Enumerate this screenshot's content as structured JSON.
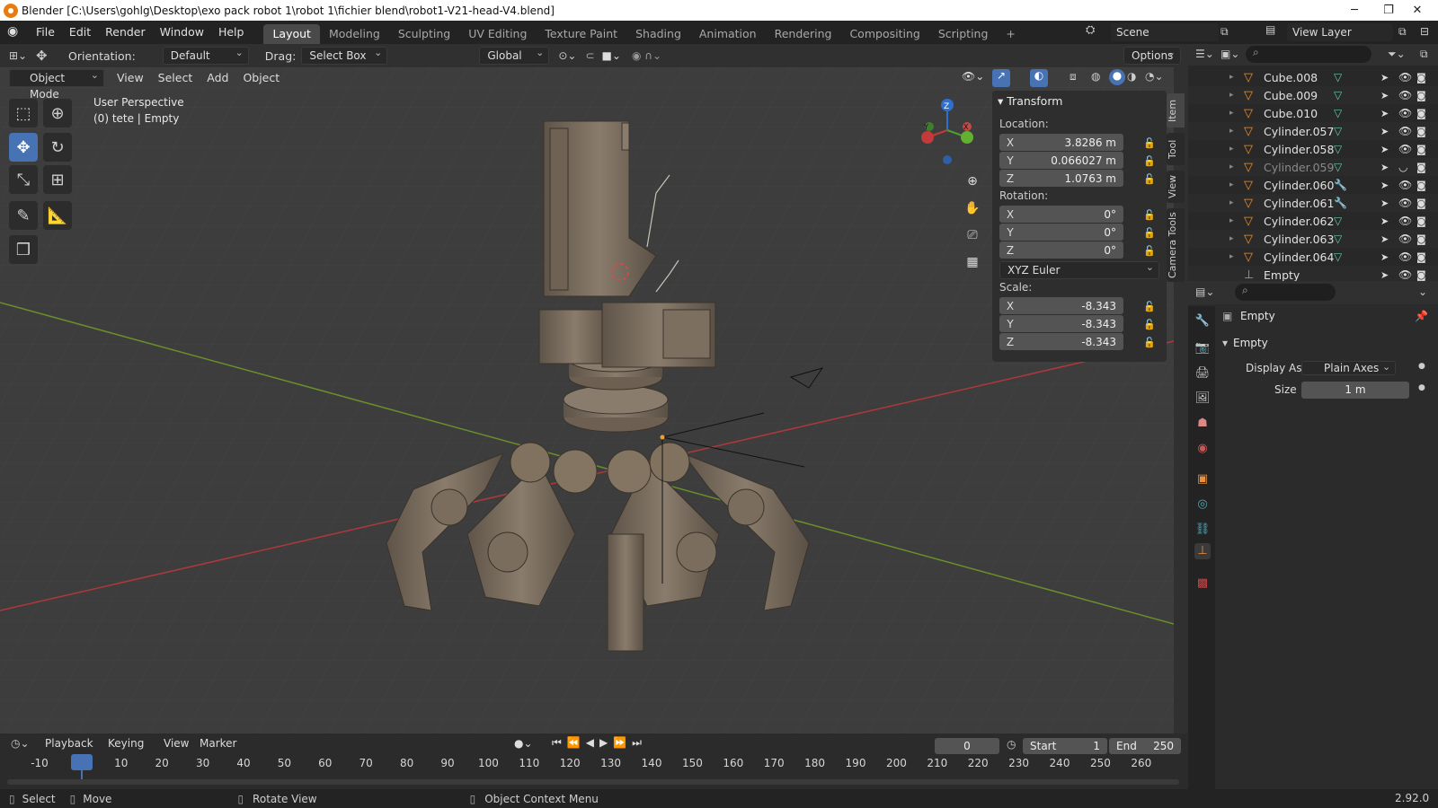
{
  "titlebar": {
    "title": "Blender [C:\\Users\\gohlg\\Desktop\\exo pack robot 1\\robot 1\\fichier blend\\robot1-V21-head-V4.blend]",
    "minimize": "─",
    "maximize": "❐",
    "close": "✕"
  },
  "menu": [
    "File",
    "Edit",
    "Render",
    "Window",
    "Help"
  ],
  "workspaces": [
    {
      "label": "Layout",
      "active": true
    },
    {
      "label": "Modeling"
    },
    {
      "label": "Sculpting"
    },
    {
      "label": "UV Editing"
    },
    {
      "label": "Texture Paint"
    },
    {
      "label": "Shading"
    },
    {
      "label": "Animation"
    },
    {
      "label": "Rendering"
    },
    {
      "label": "Compositing"
    },
    {
      "label": "Scripting"
    }
  ],
  "add_workspace": "+",
  "scene": {
    "label": "Scene"
  },
  "view_layer": {
    "label": "View Layer"
  },
  "tool_header": {
    "orientation_label": "Orientation:",
    "orientation_value": "Default",
    "drag_label": "Drag:",
    "drag_value": "Select Box",
    "transform_space": "Global",
    "options": "Options"
  },
  "viewport_header": {
    "mode": "Object Mode",
    "items": [
      "View",
      "Select",
      "Add",
      "Object"
    ]
  },
  "overlay_text": {
    "perspective": "User Perspective",
    "context": "(0) tete | Empty"
  },
  "gizmo": {
    "z": "Z",
    "y": "Y",
    "x": "X"
  },
  "npanel": {
    "section": "Transform",
    "location_label": "Location:",
    "location": [
      {
        "axis": "X",
        "value": "3.8286 m"
      },
      {
        "axis": "Y",
        "value": "0.066027 m"
      },
      {
        "axis": "Z",
        "value": "1.0763 m"
      }
    ],
    "rotation_label": "Rotation:",
    "rotation": [
      {
        "axis": "X",
        "value": "0°"
      },
      {
        "axis": "Y",
        "value": "0°"
      },
      {
        "axis": "Z",
        "value": "0°"
      }
    ],
    "rotation_mode": "XYZ Euler",
    "scale_label": "Scale:",
    "scale": [
      {
        "axis": "X",
        "value": "-8.343"
      },
      {
        "axis": "Y",
        "value": "-8.343"
      },
      {
        "axis": "Z",
        "value": "-8.343"
      }
    ]
  },
  "side_tabs": [
    {
      "label": "Item",
      "active": true
    },
    {
      "label": "Tool"
    },
    {
      "label": "View"
    },
    {
      "label": "Camera Tools"
    }
  ],
  "outliner": {
    "rows": [
      {
        "name": "Cube.008",
        "dim": false
      },
      {
        "name": "Cube.009",
        "dim": false
      },
      {
        "name": "Cube.010",
        "dim": false
      },
      {
        "name": "Cylinder.057",
        "dim": false
      },
      {
        "name": "Cylinder.058",
        "dim": false
      },
      {
        "name": "Cylinder.059",
        "dim": true
      },
      {
        "name": "Cylinder.060",
        "dim": false
      },
      {
        "name": "Cylinder.061",
        "dim": false
      },
      {
        "name": "Cylinder.062",
        "dim": false
      },
      {
        "name": "Cylinder.063",
        "dim": false
      },
      {
        "name": "Cylinder.064",
        "dim": false
      },
      {
        "name": "Empty",
        "dim": false,
        "empty": true
      }
    ]
  },
  "properties": {
    "object_name": "Empty",
    "section": "Empty",
    "display_as_label": "Display As",
    "display_as_value": "Plain Axes",
    "size_label": "Size",
    "size_value": "1 m"
  },
  "timeline": {
    "menus": [
      "Playback",
      "Keying",
      "View",
      "Marker"
    ],
    "current_frame": "0",
    "start_label": "Start",
    "start": "1",
    "end_label": "End",
    "end": "250",
    "ticks": [
      "-10",
      "0",
      "10",
      "20",
      "30",
      "40",
      "50",
      "60",
      "70",
      "80",
      "90",
      "100",
      "110",
      "120",
      "130",
      "140",
      "150",
      "160",
      "170",
      "180",
      "190",
      "200",
      "210",
      "220",
      "230",
      "240",
      "250",
      "260"
    ]
  },
  "statusbar": {
    "select": "Select",
    "move": "Move",
    "rotate": "Rotate View",
    "context": "Object Context Menu",
    "version": "2.92.0"
  },
  "colors": {
    "accent": "#4772b3",
    "orange": "#e8913a",
    "x_axis": "#c0393b",
    "y_axis": "#78a32b"
  }
}
